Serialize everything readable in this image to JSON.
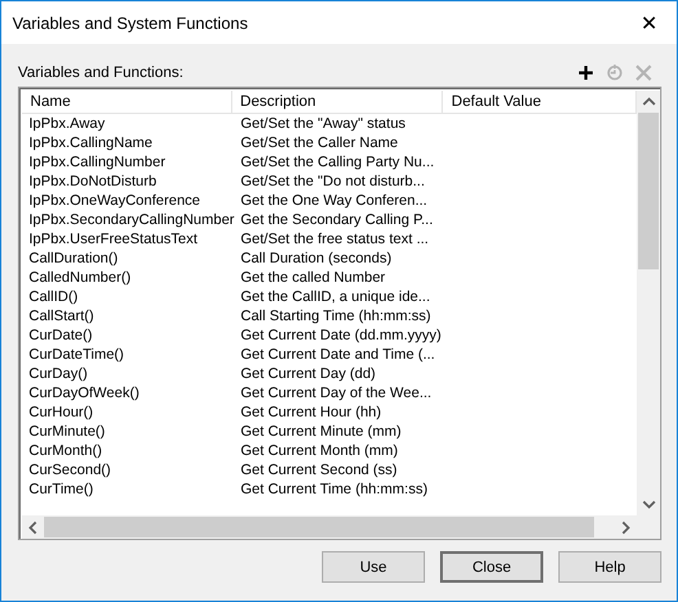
{
  "window": {
    "title": "Variables and System Functions",
    "close": "✕"
  },
  "list_label": "Variables and Functions:",
  "tools": [
    {
      "kind": "add",
      "disabled": false
    },
    {
      "kind": "refresh",
      "disabled": true
    },
    {
      "kind": "delete",
      "disabled": true
    }
  ],
  "table": {
    "columns": [
      "Name",
      "Description",
      "Default Value"
    ],
    "rows": [
      [
        "IpPbx.Away",
        "Get/Set the \"Away\" status"
      ],
      [
        "IpPbx.CallingName",
        "Get/Set the Caller Name"
      ],
      [
        "IpPbx.CallingNumber",
        "Get/Set the Calling Party Nu..."
      ],
      [
        "IpPbx.DoNotDisturb",
        "Get/Set the \"Do not disturb..."
      ],
      [
        "IpPbx.OneWayConference",
        "Get the One Way Conferen..."
      ],
      [
        "IpPbx.SecondaryCallingNumber",
        "Get the Secondary Calling P..."
      ],
      [
        "IpPbx.UserFreeStatusText",
        "Get/Set the free status text ..."
      ],
      [
        "CallDuration()",
        "Call Duration (seconds)"
      ],
      [
        "CalledNumber()",
        "Get the called Number"
      ],
      [
        "CallID()",
        "Get the CallID, a unique ide..."
      ],
      [
        "CallStart()",
        "Call Starting Time (hh:mm:ss)"
      ],
      [
        "CurDate()",
        "Get Current Date (dd.mm.yyyy)"
      ],
      [
        "CurDateTime()",
        "Get Current Date and Time (..."
      ],
      [
        "CurDay()",
        "Get Current Day (dd)"
      ],
      [
        "CurDayOfWeek()",
        "Get Current Day of the Wee..."
      ],
      [
        "CurHour()",
        "Get Current Hour (hh)"
      ],
      [
        "CurMinute()",
        "Get Current Minute (mm)"
      ],
      [
        "CurMonth()",
        "Get Current Month (mm)"
      ],
      [
        "CurSecond()",
        "Get Current Second (ss)"
      ],
      [
        "CurTime()",
        "Get Current Time (hh:mm:ss)"
      ]
    ]
  },
  "buttons": [
    {
      "label": "Use",
      "default": false
    },
    {
      "label": "Close",
      "default": true
    },
    {
      "label": "Help",
      "default": false
    }
  ]
}
